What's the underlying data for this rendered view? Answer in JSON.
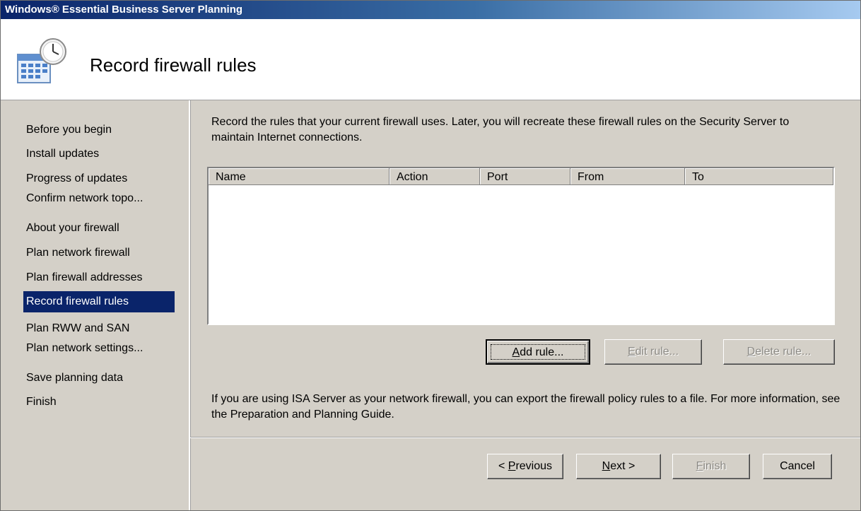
{
  "window": {
    "title": "Windows® Essential Business Server Planning"
  },
  "header": {
    "icon": "calendar-clock-icon",
    "page_title": "Record firewall rules"
  },
  "sidebar": {
    "items": [
      {
        "label": "Before you begin",
        "active": false
      },
      {
        "label": "Install updates",
        "active": false
      },
      {
        "label": "Progress of updates",
        "active": false
      },
      {
        "label": "Confirm network topo...",
        "active": false
      },
      {
        "label": "About your firewall",
        "active": false
      },
      {
        "label": "Plan network firewall",
        "active": false
      },
      {
        "label": "Plan firewall addresses",
        "active": false
      },
      {
        "label": "Record firewall rules",
        "active": true
      },
      {
        "label": "Plan RWW and SAN",
        "active": false
      },
      {
        "label": "Plan network settings...",
        "active": false
      },
      {
        "label": "Save planning data",
        "active": false
      },
      {
        "label": "Finish",
        "active": false
      }
    ]
  },
  "main": {
    "intro": "Record the rules that your current firewall uses. Later, you will recreate these firewall rules on the Security Server to maintain Internet connections.",
    "rules_table": {
      "columns": [
        "Name",
        "Action",
        "Port",
        "From",
        "To"
      ],
      "rows": []
    },
    "buttons": {
      "add_rule": {
        "label_pre": "",
        "mnemonic": "A",
        "label_post": "dd rule...",
        "enabled": true
      },
      "edit_rule": {
        "label_pre": "",
        "mnemonic": "E",
        "label_post": "dit rule...",
        "enabled": false
      },
      "delete_rule": {
        "label_pre": "",
        "mnemonic": "D",
        "label_post": "elete rule...",
        "enabled": false
      }
    },
    "note": "If you are using ISA Server as your network firewall, you can export the firewall policy rules to a file. For more information, see the Preparation and Planning Guide."
  },
  "footer": {
    "previous": {
      "label_pre": "< ",
      "mnemonic": "P",
      "label_post": "revious",
      "enabled": true
    },
    "next": {
      "label_pre": "",
      "mnemonic": "N",
      "label_post": "ext >",
      "enabled": true
    },
    "finish": {
      "label_pre": "",
      "mnemonic": "F",
      "label_post": "inish",
      "enabled": false
    },
    "cancel": {
      "label": "Cancel",
      "enabled": true
    }
  },
  "colors": {
    "selection": "#0a246a",
    "face": "#d4d0c8",
    "disabled_text": "#8c8a85"
  }
}
